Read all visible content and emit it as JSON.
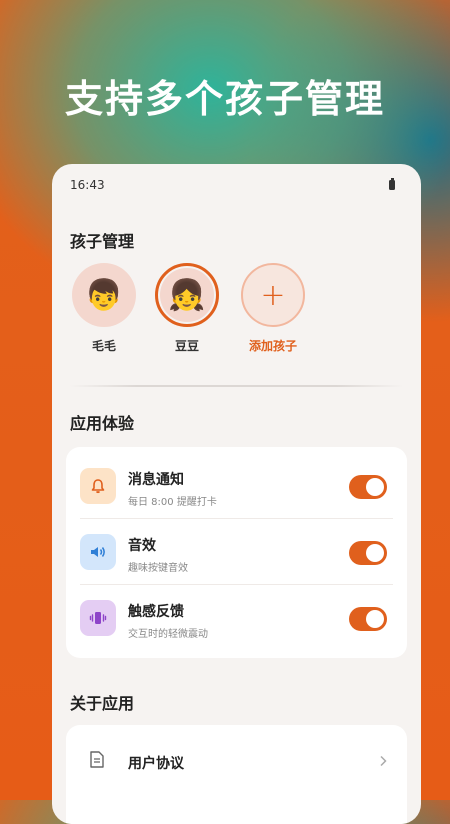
{
  "hero": {
    "title": "支持多个孩子管理"
  },
  "status_bar": {
    "time": "16:43"
  },
  "kids_section": {
    "title": "孩子管理",
    "kids": [
      {
        "name": "毛毛",
        "avatar": "👦",
        "selected": false
      },
      {
        "name": "豆豆",
        "avatar": "👧",
        "selected": true
      }
    ],
    "add_label": "添加孩子",
    "add_symbol": "+"
  },
  "app_section": {
    "title": "应用体验",
    "settings": [
      {
        "title": "消息通知",
        "subtitle": "每日 8:00 提醒打卡",
        "icon": "bell-icon",
        "enabled": true
      },
      {
        "title": "音效",
        "subtitle": "趣味按键音效",
        "icon": "speaker-icon",
        "enabled": true
      },
      {
        "title": "触感反馈",
        "subtitle": "交互时的轻微震动",
        "icon": "vibration-icon",
        "enabled": true
      }
    ]
  },
  "about_section": {
    "title": "关于应用",
    "items": [
      {
        "label": "用户协议",
        "icon": "document-icon"
      }
    ]
  },
  "colors": {
    "accent": "#e0601d",
    "background": "#f6f3f1"
  }
}
